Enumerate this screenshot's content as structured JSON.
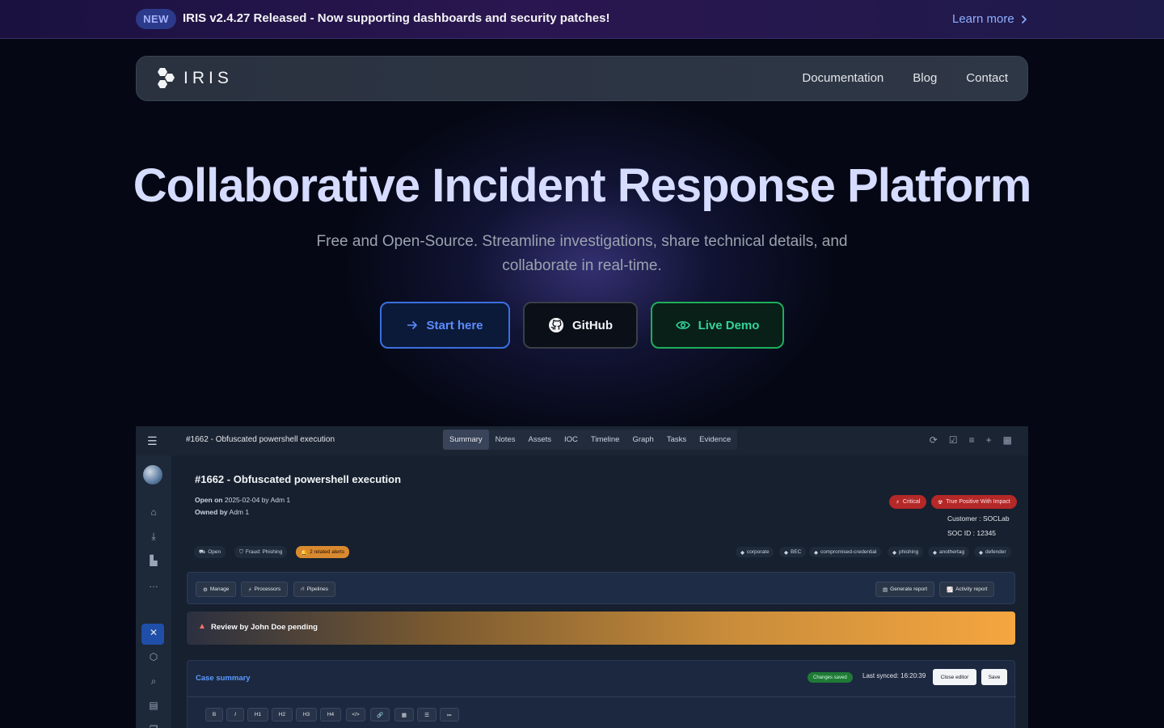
{
  "announcement": {
    "badge": "NEW",
    "message": "IRIS v2.4.27 Released - Now supporting dashboards and security patches!",
    "link_label": "Learn more"
  },
  "nav": {
    "logo_text": "IRIS",
    "links": [
      "Documentation",
      "Blog",
      "Contact"
    ]
  },
  "hero": {
    "title": "Collaborative Incident Response Platform",
    "subtitle": "Free and Open-Source. Streamline investigations, share technical details, and collaborate in real-time.",
    "buttons": {
      "start": "Start here",
      "github": "GitHub",
      "demo": "Live Demo"
    }
  },
  "app": {
    "top_title": "#1662 - Obfuscated powershell execution",
    "tabs": [
      "Summary",
      "Notes",
      "Assets",
      "IOC",
      "Timeline",
      "Graph",
      "Tasks",
      "Evidence"
    ],
    "active_tab": "Summary",
    "case_title": "#1662 - Obfuscated powershell execution",
    "open_label": "Open on",
    "open_value": "2025-02-04 by Adm 1",
    "owned_label": "Owned by",
    "owned_value": "Adm 1",
    "badges": {
      "critical": "Critical",
      "classification": "True Positive With Impact"
    },
    "customer_label": "Customer :",
    "customer_value": "SOCLab",
    "soc_label": "SOC ID :",
    "soc_value": "12345",
    "status_pills": [
      "Open",
      "Fraud: Phishing",
      "2 related alerts"
    ],
    "tags": [
      "corporate",
      "BEC",
      "compromised-credential",
      "phishing",
      "anothertag",
      "defender"
    ],
    "toolbar_left": [
      "Manage",
      "Processors",
      "Pipelines"
    ],
    "toolbar_right": [
      "Generate report",
      "Activity report"
    ],
    "warning": "Review by John Doe pending",
    "summary": {
      "title": "Case summary",
      "saved": "Changes saved",
      "last_synced": "Last synced: 16:20:39",
      "close_editor": "Close editor",
      "save": "Save",
      "editor_buttons": [
        "B",
        "I",
        "H1",
        "H2",
        "H3",
        "H4",
        "</>",
        "🔗",
        "▦",
        "☰",
        "≔"
      ]
    }
  },
  "colors": {
    "accent_blue": "#3b6fe0",
    "accent_green": "#1fae5a",
    "critical_red": "#c0302f",
    "alert_orange": "#e8a040"
  }
}
